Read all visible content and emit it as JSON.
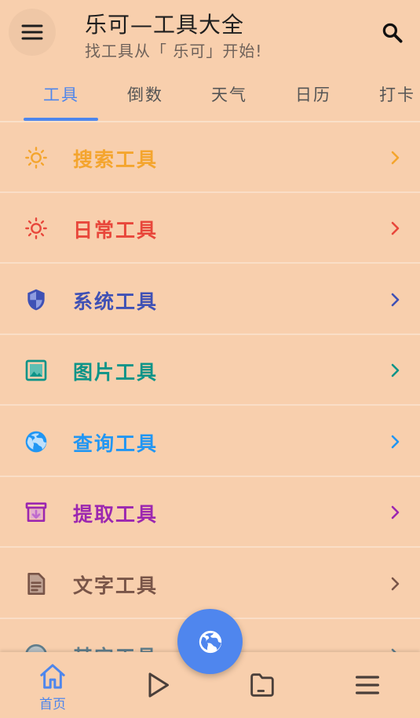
{
  "header": {
    "title": "乐可—工具大全",
    "subtitle": "找工具从「 乐可」开始!",
    "menu_icon": "menu-icon",
    "search_icon": "search-icon"
  },
  "tabs": [
    {
      "label": "工具",
      "active": true
    },
    {
      "label": "倒数",
      "active": false
    },
    {
      "label": "天气",
      "active": false
    },
    {
      "label": "日历",
      "active": false
    },
    {
      "label": "打卡",
      "active": false
    }
  ],
  "colors": {
    "background": "#f8cfad",
    "accent": "#4e86ec"
  },
  "tools": [
    {
      "label": "搜索工具",
      "icon": "sun-icon",
      "color": "#f4a52e"
    },
    {
      "label": "日常工具",
      "icon": "sun-icon",
      "color": "#e8473b"
    },
    {
      "label": "系统工具",
      "icon": "shield-icon",
      "color": "#3f51b5"
    },
    {
      "label": "图片工具",
      "icon": "image-icon",
      "color": "#0d9488"
    },
    {
      "label": "查询工具",
      "icon": "globe-icon",
      "color": "#2196f3"
    },
    {
      "label": "提取工具",
      "icon": "archive-icon",
      "color": "#9c27b0"
    },
    {
      "label": "文字工具",
      "icon": "document-icon",
      "color": "#795548"
    },
    {
      "label": "其它工具",
      "icon": "circle-icon",
      "color": "#607d8b"
    }
  ],
  "bottom_nav": [
    {
      "label": "首页",
      "icon": "home-icon",
      "active": true
    },
    {
      "label": "",
      "icon": "play-icon",
      "active": false
    },
    {
      "label": "",
      "icon": "folder-icon",
      "active": false
    },
    {
      "label": "",
      "icon": "menu-icon",
      "active": false
    }
  ],
  "fab": {
    "icon": "globe-icon"
  }
}
